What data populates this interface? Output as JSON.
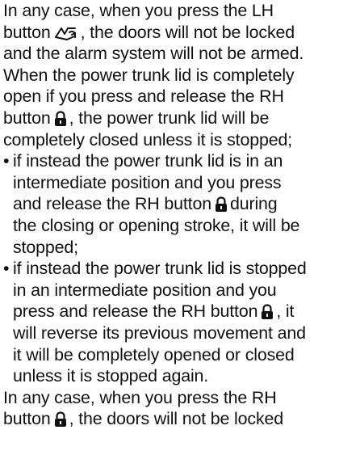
{
  "document": {
    "paragraph1": {
      "line1": "In any case, when you press the LH",
      "line2_before": "button",
      "line2_after": ", the doors will not be locked",
      "line3": "and the alarm system will not be armed."
    },
    "paragraph2": {
      "line1": "When the power trunk lid is completely",
      "line2": "open if you press and release the RH",
      "line3_before": "button",
      "line3_after": ", the power trunk lid will be",
      "line4": "completely closed unless it is stopped;"
    },
    "bullets": [
      {
        "marker": "•",
        "line1": "if instead the power trunk lid is in an",
        "line2": "intermediate position and you press",
        "line3_before": "and release the RH button",
        "line3_after": "during",
        "line4": "the closing or opening stroke, it will be",
        "line5": "stopped;"
      },
      {
        "marker": "•",
        "line1": "if instead the power trunk lid is stopped",
        "line2": "in an intermediate position and you",
        "line3_before": "press and release the RH button",
        "line3_after": ", it",
        "line4": "will reverse its previous movement and",
        "line5": "it will be completely opened or closed",
        "line6": "unless it is stopped again."
      }
    ],
    "paragraph3": {
      "line1": "In any case, when you press the RH",
      "line2_before": "button",
      "line2_after": ", the doors will not be locked"
    }
  },
  "icons": {
    "trunk_open": "trunk-open-icon",
    "padlock": "padlock-icon"
  },
  "colors": {
    "text": "#111111",
    "background": "#ffffff"
  }
}
